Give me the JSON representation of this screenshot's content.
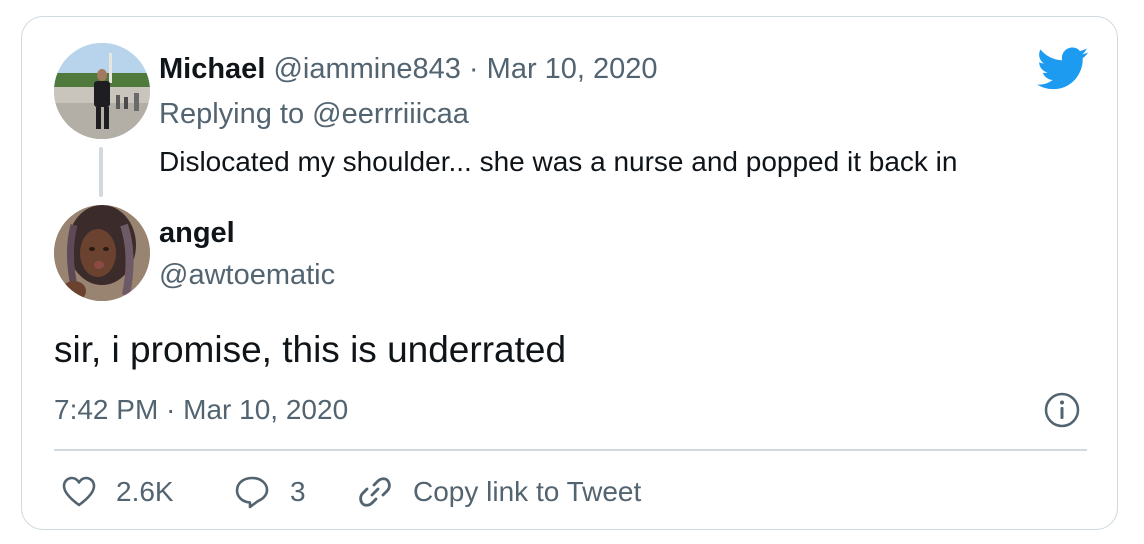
{
  "parent_tweet": {
    "author_name": "Michael",
    "author_handle": "@iammine843",
    "separator": "·",
    "date": "Mar 10, 2020",
    "replying_to": "Replying to @eerrriiicaa",
    "text": "Dislocated my shoulder... she was a nurse and popped it back in"
  },
  "tweet": {
    "author_name": "angel",
    "author_handle": "@awtoematic",
    "text": "sir, i promise, this is underrated",
    "timestamp": "7:42 PM · Mar 10, 2020"
  },
  "actions": {
    "like_count": "2.6K",
    "reply_count": "3",
    "copy_link_label": "Copy link to Tweet"
  },
  "icons": {
    "brand": "twitter-bird-icon",
    "info": "info-icon",
    "like": "heart-icon",
    "reply": "comment-bubble-icon",
    "copy": "link-icon"
  },
  "colors": {
    "brand_blue": "#1d9bf0",
    "secondary_text": "#536471",
    "primary_text": "#0f1419",
    "border": "#cfd9de"
  }
}
